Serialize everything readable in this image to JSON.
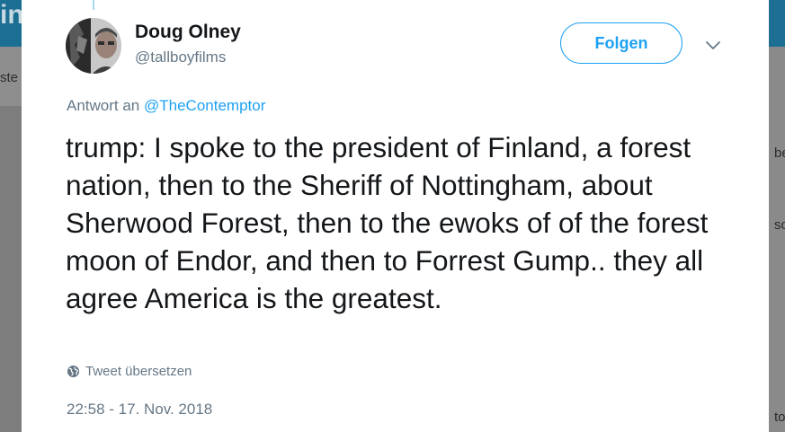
{
  "background": {
    "logo_fragment": "in",
    "nav_fragment": "ste",
    "right_fragments": [
      "be",
      "sc",
      "to"
    ]
  },
  "tweet": {
    "author_name": "Doug Olney",
    "author_handle": "@tallboyfilms",
    "follow_label": "Folgen",
    "reply_prefix": "Antwort an",
    "reply_mention": "@TheContemptor",
    "text": "trump: I spoke to the president of Finland, a forest nation, then to the Sheriff of Nottingham, about Sherwood Forest, then to the ewoks of of the forest moon of Endor, and then to Forrest Gump.. they all agree America is the greatest.",
    "translate_label": "Tweet übersetzen",
    "timestamp": "22:58 - 17. Nov. 2018"
  },
  "icons": {
    "chevron": "chevron-down-icon",
    "translate": "globe-icon",
    "avatar": "avatar"
  },
  "colors": {
    "accent": "#1da1f2",
    "secondary_text": "#657786",
    "primary_text": "#14171a",
    "topbar": "#1c6e93"
  }
}
